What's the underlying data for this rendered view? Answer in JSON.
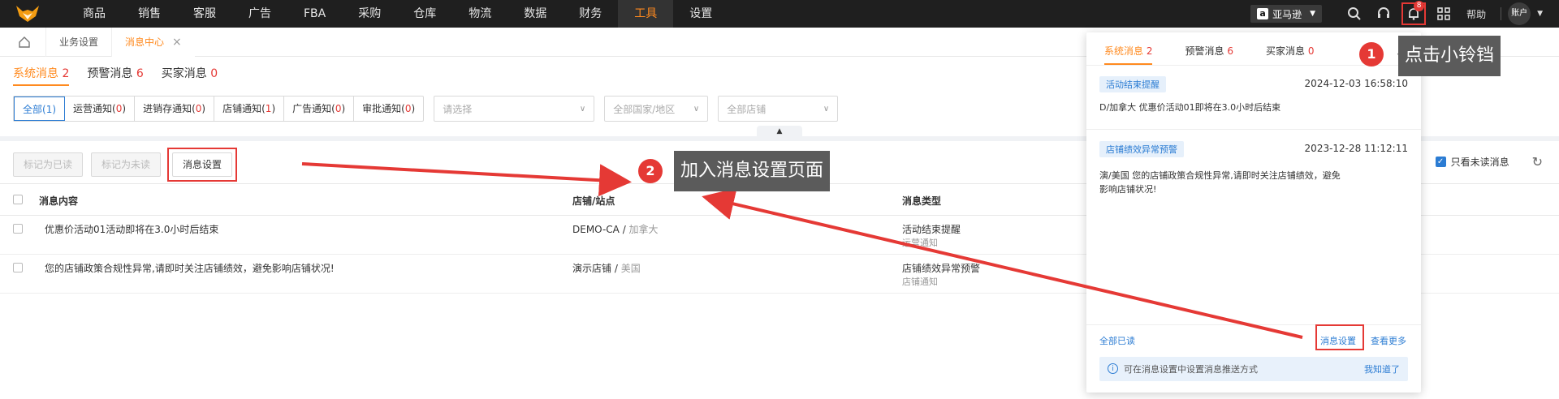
{
  "nav": {
    "items": [
      "商品",
      "销售",
      "客服",
      "广告",
      "FBA",
      "采购",
      "仓库",
      "物流",
      "数据",
      "财务",
      "工具",
      "设置"
    ],
    "active_index": 10,
    "marketplace": "亚马逊",
    "bell_badge": "8",
    "help": "帮助",
    "account": "账户"
  },
  "tabbar": {
    "tabs": [
      "业务设置",
      "消息中心"
    ],
    "active_index": 1,
    "close_glyph": "×"
  },
  "msg_tabs": [
    {
      "label": "系统消息",
      "count": "2"
    },
    {
      "label": "预警消息",
      "count": "6"
    },
    {
      "label": "买家消息",
      "count": "0"
    }
  ],
  "filters": {
    "segments": [
      {
        "label": "全部",
        "count": "1"
      },
      {
        "label": "运营通知",
        "count": "0"
      },
      {
        "label": "进销存通知",
        "count": "0"
      },
      {
        "label": "店铺通知",
        "count": "1"
      },
      {
        "label": "广告通知",
        "count": "0"
      },
      {
        "label": "审批通知",
        "count": "0"
      }
    ],
    "select_placeholder": "请选择",
    "country_placeholder": "全部国家/地区",
    "shop_placeholder": "全部店铺"
  },
  "actions": {
    "mark_read": "标记为已读",
    "mark_unread": "标记为未读",
    "settings": "消息设置"
  },
  "right_tools": {
    "only_unread": "只看未读消息"
  },
  "table": {
    "headers": [
      "消息内容",
      "店铺/站点",
      "消息类型"
    ],
    "rows": [
      {
        "content": "优惠价活动01活动即将在3.0小时后结束",
        "shop": "DEMO-CA",
        "site": "加拿大",
        "type": "活动结束提醒",
        "subtype": "运营通知"
      },
      {
        "content": "您的店铺政策合规性异常,请即时关注店铺绩效，避免影响店铺状况!",
        "shop": "演示店铺",
        "site": "美国",
        "type": "店铺绩效异常预警",
        "subtype": "店铺通知"
      }
    ]
  },
  "panel": {
    "tabs": [
      {
        "label": "系统消息",
        "count": "2"
      },
      {
        "label": "预警消息",
        "count": "6"
      },
      {
        "label": "买家消息",
        "count": "0"
      }
    ],
    "notices": [
      {
        "tag": "活动结束提醒",
        "time": "2024-12-03 16:58:10",
        "text": "D/加拿大 优惠价活动01即将在3.0小时后结束"
      },
      {
        "tag": "店铺绩效异常预警",
        "time": "2023-12-28 11:12:11",
        "text": "演/美国 您的店铺政策合规性异常,请即时关注店铺绩效，避免影响店铺状况!"
      }
    ],
    "read_all": "全部已读",
    "settings": "消息设置",
    "more": "查看更多",
    "info": "可在消息设置中设置消息推送方式",
    "got_it": "我知道了"
  },
  "annotations": {
    "step1_num": "1",
    "step1_text": "点击小铃铛",
    "step2_num": "2",
    "step2_text": "加入消息设置页面"
  },
  "colors": {
    "accent": "#ff8a1f",
    "red": "#e53935",
    "blue": "#2b7cd3"
  }
}
